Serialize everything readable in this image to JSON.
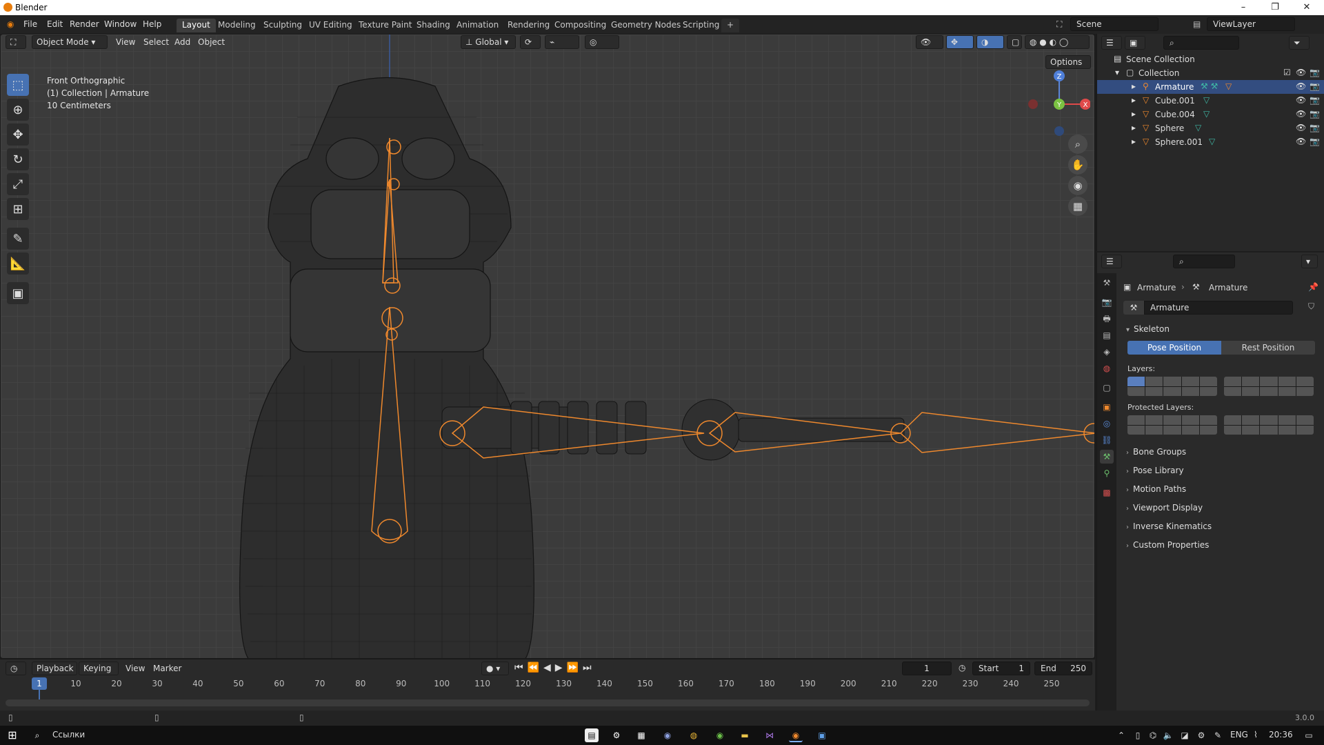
{
  "window": {
    "title": "Blender",
    "minimize": "–",
    "restore": "❐",
    "close": "✕"
  },
  "menu": [
    "File",
    "Edit",
    "Render",
    "Window",
    "Help"
  ],
  "workspaces": [
    "Layout",
    "Modeling",
    "Sculpting",
    "UV Editing",
    "Texture Paint",
    "Shading",
    "Animation",
    "Rendering",
    "Compositing",
    "Geometry Nodes",
    "Scripting"
  ],
  "active_workspace": "Layout",
  "add_workspace": "+",
  "scene": {
    "label": "Scene",
    "view_layer": "ViewLayer"
  },
  "viewport_header": {
    "mode": "Object Mode",
    "menus": [
      "View",
      "Select",
      "Add",
      "Object"
    ],
    "orientation": "Global",
    "options": "Options"
  },
  "viewport_overlay": {
    "view_name": "Front Orthographic",
    "context": "(1) Collection | Armature",
    "scale": "10 Centimeters"
  },
  "gizmo": {
    "x": "X",
    "y": "Y",
    "z": "Z"
  },
  "outliner": {
    "root": "Scene Collection",
    "collection": "Collection",
    "items": [
      {
        "name": "Armature",
        "selected": true
      },
      {
        "name": "Cube.001",
        "selected": false
      },
      {
        "name": "Cube.004",
        "selected": false
      },
      {
        "name": "Sphere",
        "selected": false
      },
      {
        "name": "Sphere.001",
        "selected": false
      }
    ]
  },
  "properties": {
    "breadcrumb_object": "Armature",
    "breadcrumb_data": "Armature",
    "data_name": "Armature",
    "skeleton": {
      "title": "Skeleton",
      "pose_position": "Pose Position",
      "rest_position": "Rest Position",
      "layers_label": "Layers:",
      "protected_layers_label": "Protected Layers:"
    },
    "panels": [
      "Bone Groups",
      "Pose Library",
      "Motion Paths",
      "Viewport Display",
      "Inverse Kinematics",
      "Custom Properties"
    ]
  },
  "timeline": {
    "menus": [
      "Playback",
      "Keying",
      "View",
      "Marker"
    ],
    "current_frame": "1",
    "start_label": "Start",
    "start": "1",
    "end_label": "End",
    "end": "250",
    "ticks": [
      "1",
      "10",
      "20",
      "30",
      "40",
      "50",
      "60",
      "70",
      "80",
      "90",
      "100",
      "110",
      "120",
      "130",
      "140",
      "150",
      "160",
      "170",
      "180",
      "190",
      "200",
      "210",
      "220",
      "230",
      "240",
      "250"
    ]
  },
  "statusbar": {
    "version": "3.0.0"
  },
  "taskbar": {
    "search": "Ссылки",
    "language": "ENG",
    "time": "20:36"
  }
}
